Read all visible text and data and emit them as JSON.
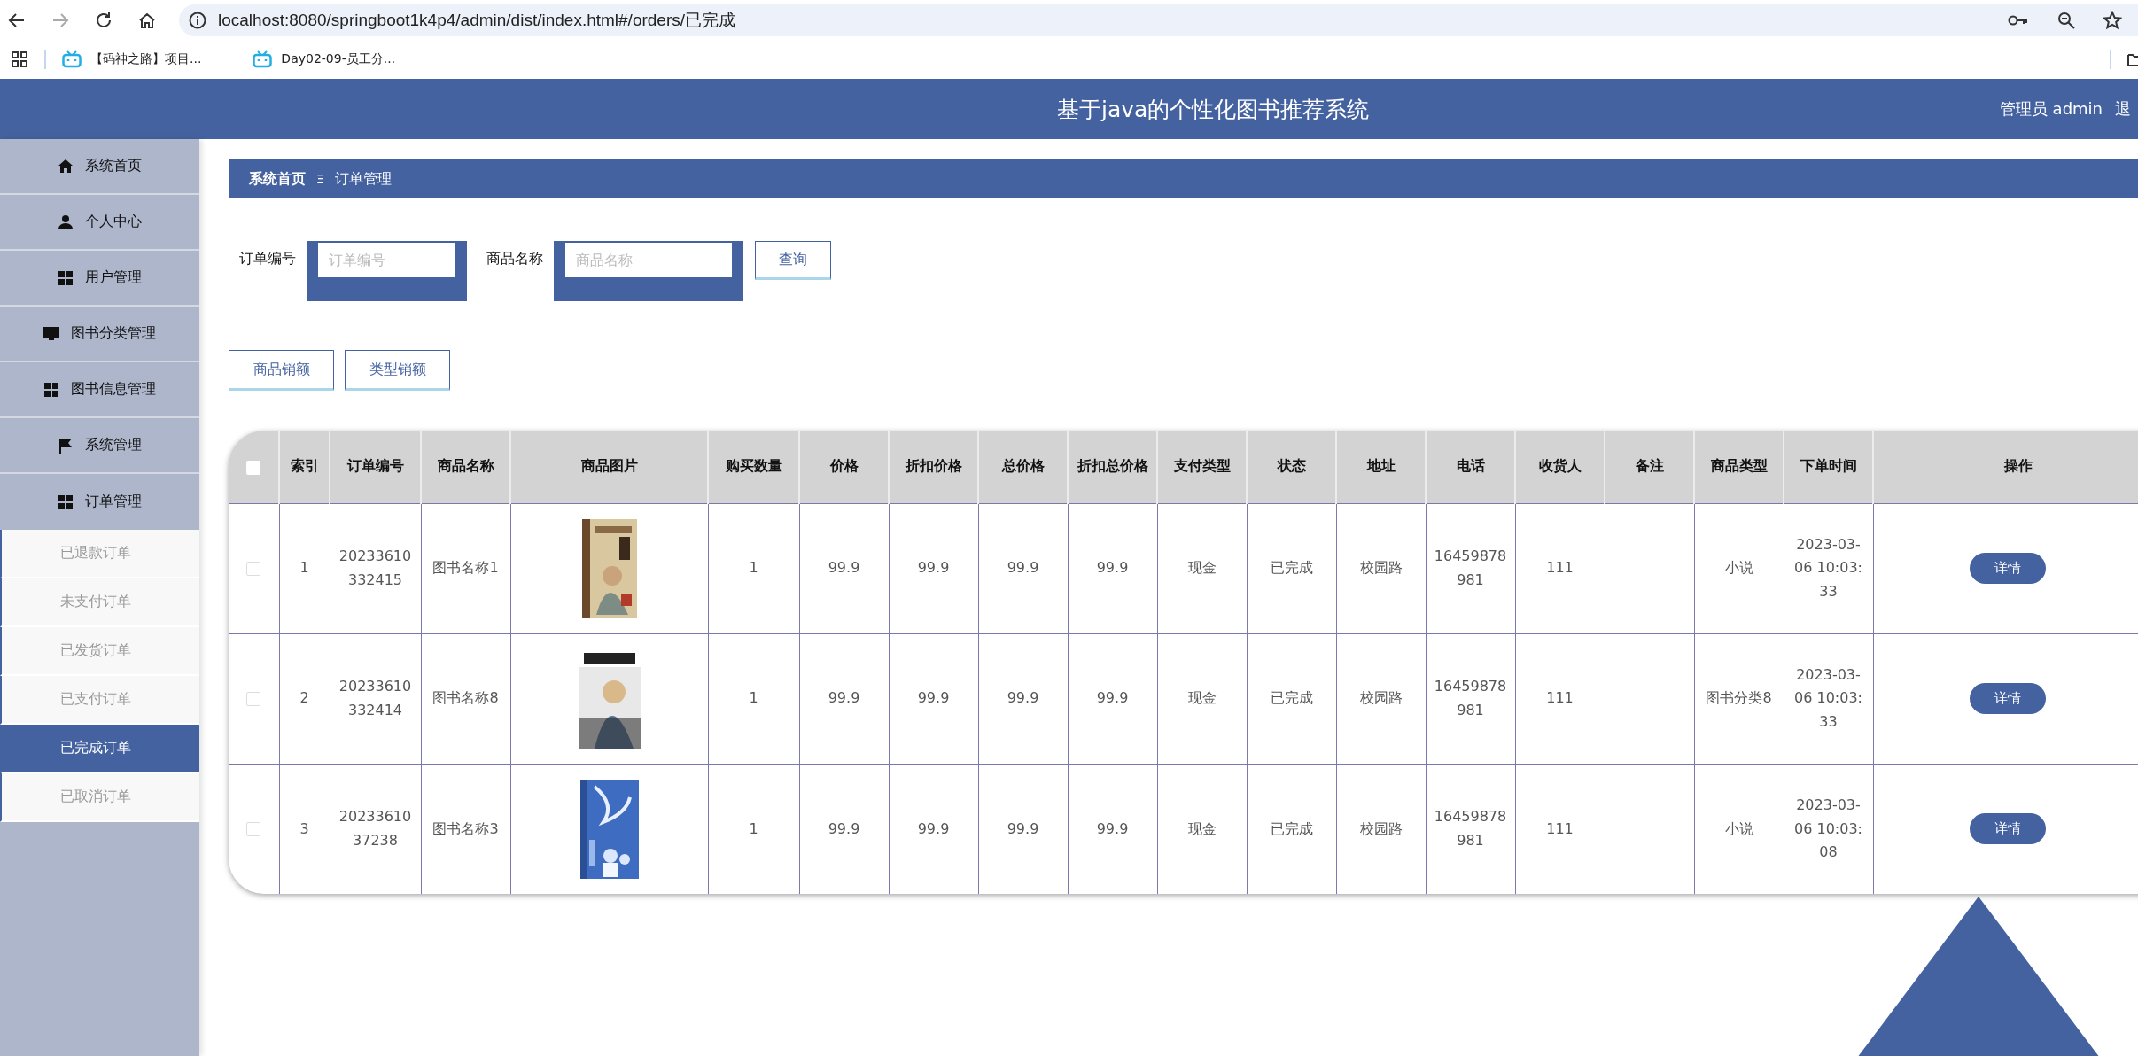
{
  "browser": {
    "url": "localhost:8080/springboot1k4p4/admin/dist/index.html#/orders/已完成",
    "bookmarks": [
      {
        "label": "【码神之路】项目..."
      },
      {
        "label": "Day02-09-员工分..."
      }
    ]
  },
  "header": {
    "title": "基于java的个性化图书推荐系统",
    "user": "管理员 admin",
    "logout": "退"
  },
  "sidebar": {
    "items": [
      {
        "label": "系统首页",
        "expanded": false
      },
      {
        "label": "个人中心",
        "expanded": false
      },
      {
        "label": "用户管理",
        "expanded": false
      },
      {
        "label": "图书分类管理",
        "expanded": false
      },
      {
        "label": "图书信息管理",
        "expanded": false
      },
      {
        "label": "系统管理",
        "expanded": false
      },
      {
        "label": "订单管理",
        "expanded": true,
        "children": [
          {
            "label": "已退款订单",
            "selected": false
          },
          {
            "label": "未支付订单",
            "selected": false
          },
          {
            "label": "已发货订单",
            "selected": false
          },
          {
            "label": "已支付订单",
            "selected": false
          },
          {
            "label": "已完成订单",
            "selected": true
          },
          {
            "label": "已取消订单",
            "selected": false
          }
        ]
      }
    ]
  },
  "breadcrumb": {
    "home": "系统首页",
    "separator": "Ξ",
    "current": "订单管理"
  },
  "search": {
    "fields": [
      {
        "label": "订单编号",
        "placeholder": "订单编号"
      },
      {
        "label": "商品名称",
        "placeholder": "商品名称"
      }
    ],
    "button": "查询"
  },
  "actions": [
    "商品销额",
    "类型销额"
  ],
  "table": {
    "select_all": {
      "checked": false
    },
    "columns": [
      "索引",
      "订单编号",
      "商品名称",
      "商品图片",
      "购买数量",
      "价格",
      "折扣价格",
      "总价格",
      "折扣总价格",
      "支付类型",
      "状态",
      "地址",
      "电话",
      "收货人",
      "备注",
      "商品类型",
      "下单时间",
      "操作"
    ],
    "rows": [
      {
        "checked": false,
        "index": "1",
        "order_no": "20233610332415",
        "name": "图书名称1",
        "quantity": "1",
        "price": "99.9",
        "discount_price": "99.9",
        "total": "99.9",
        "discount_total": "99.9",
        "payment": "现金",
        "status": "已完成",
        "address": "校园路",
        "phone": "16459878981",
        "receiver": "111",
        "category": "小说",
        "time": "2023-03-06 10:03:33",
        "action": "详情"
      },
      {
        "checked": false,
        "index": "2",
        "order_no": "20233610332414",
        "name": "图书名称8",
        "quantity": "1",
        "price": "99.9",
        "discount_price": "99.9",
        "total": "99.9",
        "discount_total": "99.9",
        "payment": "现金",
        "status": "已完成",
        "address": "校园路",
        "phone": "16459878981",
        "receiver": "111",
        "category": "图书分类8",
        "time": "2023-03-06 10:03:33",
        "action": "详情"
      },
      {
        "checked": false,
        "index": "3",
        "order_no": "2023361037238",
        "name": "图书名称3",
        "quantity": "1",
        "price": "99.9",
        "discount_price": "99.9",
        "total": "99.9",
        "discount_total": "99.9",
        "payment": "现金",
        "status": "已完成",
        "address": "校园路",
        "phone": "16459878981",
        "receiver": "111",
        "category": "小说",
        "time": "2023-03-06 10:03:08",
        "action": "详情"
      }
    ]
  }
}
